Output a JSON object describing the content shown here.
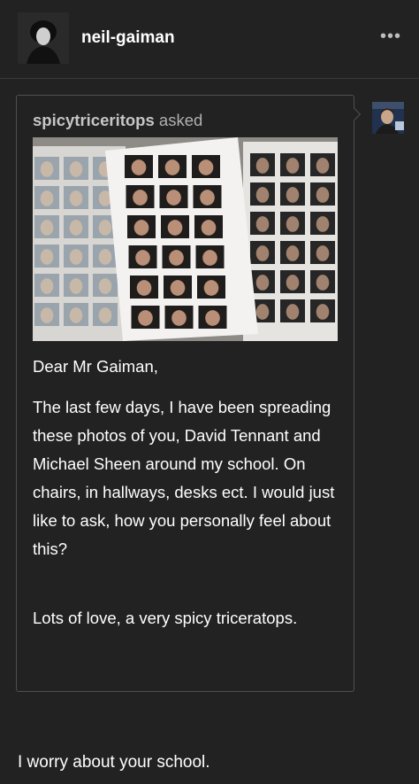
{
  "post": {
    "blog_name": "neil-gaiman",
    "more_label": "•••",
    "ask": {
      "asker_name": "spicytriceritops",
      "asked_suffix": "asked",
      "greeting": "Dear Mr Gaiman,",
      "body": "The last few days, I have been spreading these photos of you, David Tennant and Michael Sheen around my school. On chairs, in hallways, desks ect. I would just like to ask, how you personally feel about this?",
      "signoff": "Lots of love, a very spicy triceratops."
    },
    "answer": "I worry about your school."
  },
  "icons": {
    "more": "more-dots-icon",
    "blog_avatar": "blog-avatar",
    "asker_avatar": "asker-avatar"
  },
  "colors": {
    "background": "#222222",
    "border": "#4f4f4f",
    "muted_text": "#b0b0b0",
    "text": "#ffffff"
  }
}
